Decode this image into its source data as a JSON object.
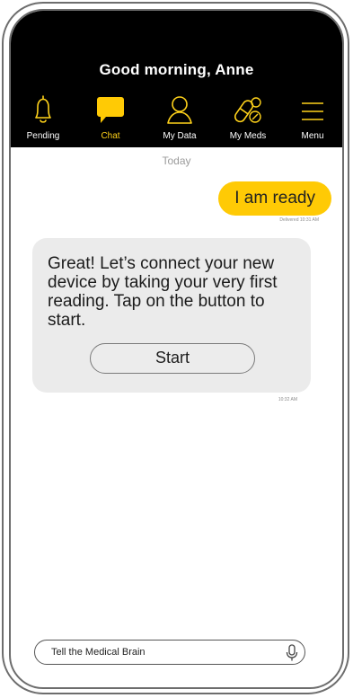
{
  "header": {
    "greeting": "Good morning, Anne"
  },
  "nav": {
    "items": [
      {
        "label": "Pending",
        "icon": "bell-icon",
        "active": false
      },
      {
        "label": "Chat",
        "icon": "chat-bubble-icon",
        "active": true
      },
      {
        "label": "My Data",
        "icon": "person-icon",
        "active": false
      },
      {
        "label": "My Meds",
        "icon": "pill-icon",
        "active": false
      },
      {
        "label": "Menu",
        "icon": "hamburger-menu-icon",
        "active": false
      }
    ]
  },
  "chat": {
    "date": "Today",
    "outgoing": {
      "text": "I am ready",
      "meta": "Delivered 10:31 AM"
    },
    "incoming": {
      "text": "Great!  Let’s connect your new device by taking your very first reading. Tap on the button to start.",
      "button_label": "Start",
      "meta": "10:32 AM"
    }
  },
  "input": {
    "placeholder": "Tell the Medical Brain",
    "value": "Tell the Medical Brain",
    "mic_icon": "microphone-icon"
  },
  "colors": {
    "header_bg": "#000000",
    "accent": "#ffca05",
    "icon_stroke": "#ffd21a",
    "bubble_in": "#ebebeb"
  }
}
